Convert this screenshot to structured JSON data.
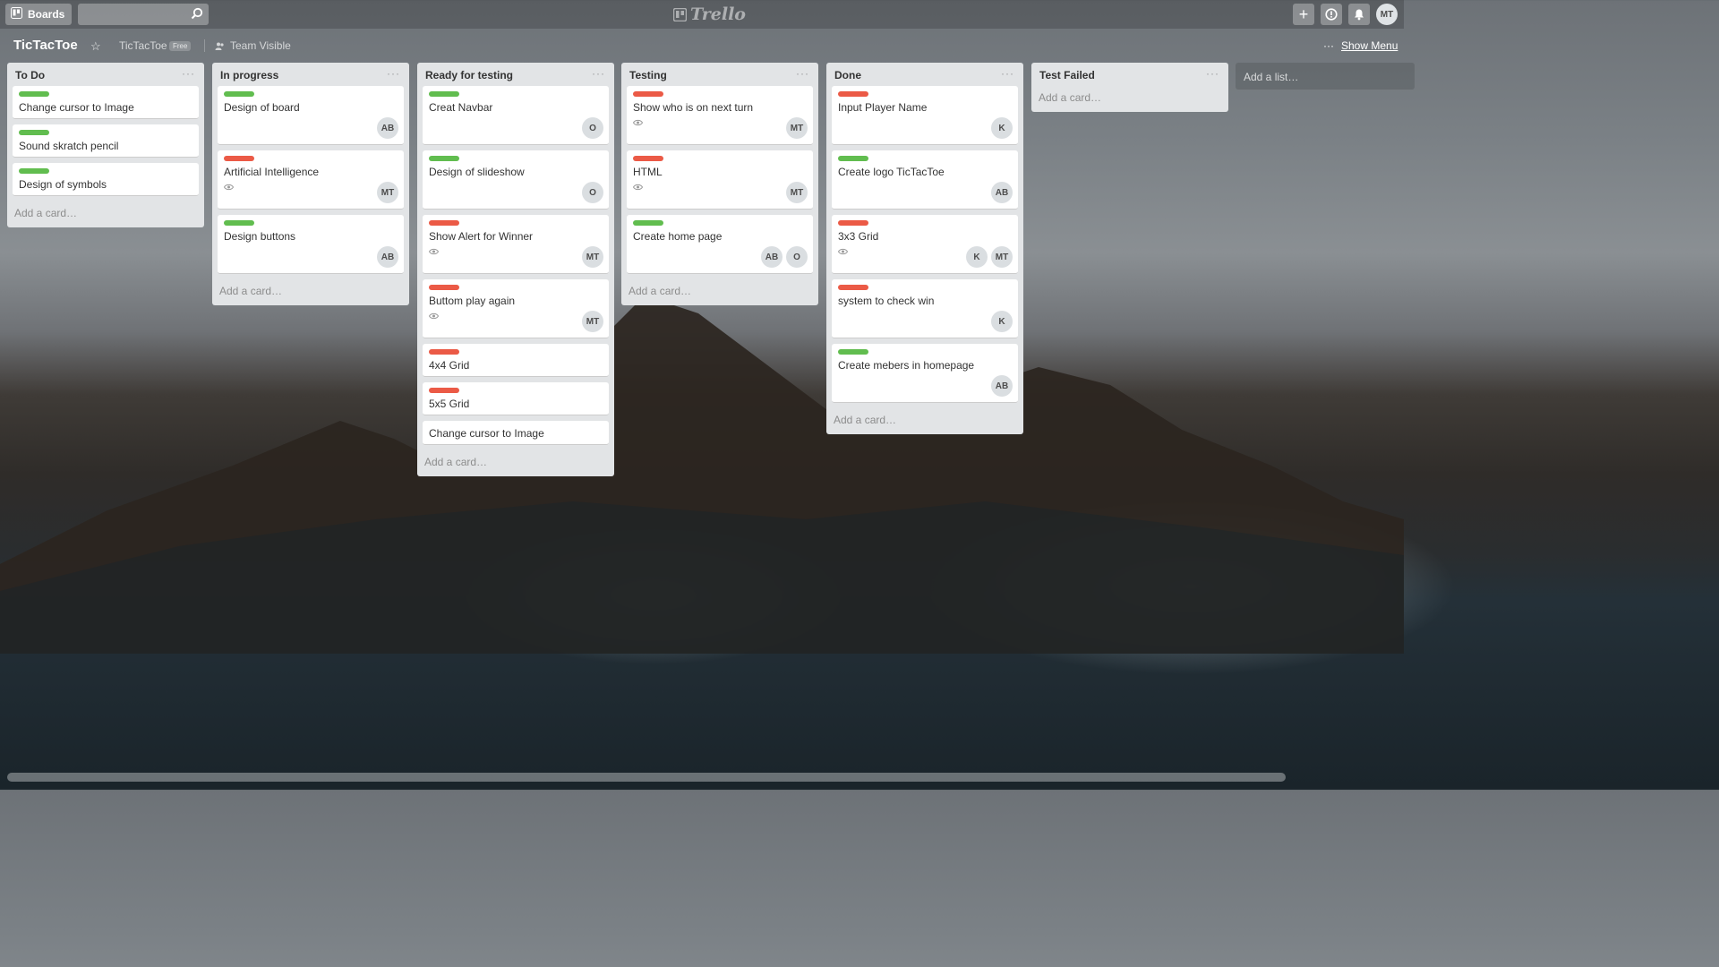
{
  "header": {
    "boards_label": "Boards",
    "search_value": "",
    "logo_text": "Trello",
    "user_initials": "MT"
  },
  "board": {
    "title": "TicTacToe",
    "team": "TicTacToe",
    "plan_badge": "Free",
    "visibility": "Team Visible",
    "show_menu": "Show Menu"
  },
  "lists": [
    {
      "title": "To Do",
      "cards": [
        {
          "label": "green",
          "title": "Change cursor to Image",
          "members": [],
          "watch": false
        },
        {
          "label": "green",
          "title": "Sound skratch pencil",
          "members": [],
          "watch": false
        },
        {
          "label": "green",
          "title": "Design of symbols",
          "members": [],
          "watch": false
        }
      ],
      "add_card": "Add a card…"
    },
    {
      "title": "In progress",
      "cards": [
        {
          "label": "green",
          "title": "Design of board",
          "members": [
            "AB"
          ],
          "watch": false
        },
        {
          "label": "red",
          "title": "Artificial Intelligence",
          "members": [
            "MT"
          ],
          "watch": true
        },
        {
          "label": "green",
          "title": "Design buttons",
          "members": [
            "AB"
          ],
          "watch": false
        }
      ],
      "add_card": "Add a card…"
    },
    {
      "title": "Ready for testing",
      "cards": [
        {
          "label": "green",
          "title": "Creat Navbar",
          "members": [
            "O"
          ],
          "watch": false
        },
        {
          "label": "green",
          "title": "Design of slideshow",
          "members": [
            "O"
          ],
          "watch": false
        },
        {
          "label": "red",
          "title": "Show Alert for Winner",
          "members": [
            "MT"
          ],
          "watch": true
        },
        {
          "label": "red",
          "title": "Buttom play again",
          "members": [
            "MT"
          ],
          "watch": true
        },
        {
          "label": "red",
          "title": "4x4 Grid",
          "members": [],
          "watch": false
        },
        {
          "label": "red",
          "title": "5x5 Grid",
          "members": [],
          "watch": false
        },
        {
          "label": "",
          "title": "Change cursor to Image",
          "members": [],
          "watch": false
        }
      ],
      "add_card": "Add a card…"
    },
    {
      "title": "Testing",
      "cards": [
        {
          "label": "red",
          "title": "Show who is on next turn",
          "members": [
            "MT"
          ],
          "watch": true
        },
        {
          "label": "red",
          "title": "HTML",
          "members": [
            "MT"
          ],
          "watch": true
        },
        {
          "label": "green",
          "title": "Create home page",
          "members": [
            "AB",
            "O"
          ],
          "watch": false
        }
      ],
      "add_card": "Add a card…"
    },
    {
      "title": "Done",
      "cards": [
        {
          "label": "red",
          "title": "Input Player Name",
          "members": [
            "K"
          ],
          "watch": false
        },
        {
          "label": "green",
          "title": "Create logo TicTacToe",
          "members": [
            "AB"
          ],
          "watch": false
        },
        {
          "label": "red",
          "title": "3x3 Grid",
          "members": [
            "K",
            "MT"
          ],
          "watch": true
        },
        {
          "label": "red",
          "title": "system to check win",
          "members": [
            "K"
          ],
          "watch": false
        },
        {
          "label": "green",
          "title": "Create mebers in homepage",
          "members": [
            "AB"
          ],
          "watch": false
        }
      ],
      "add_card": "Add a card…"
    },
    {
      "title": "Test Failed",
      "cards": [],
      "add_card": "Add a card…"
    }
  ],
  "add_list": "Add a list…",
  "colors": {
    "label_green": "#61bd4f",
    "label_red": "#eb5a46",
    "list_bg": "#e2e4e6"
  }
}
